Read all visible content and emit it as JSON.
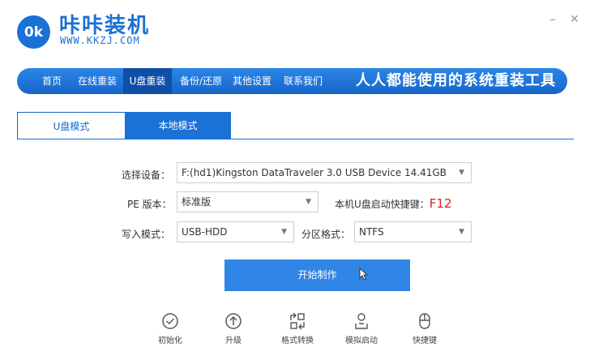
{
  "header": {
    "logo_text": "0k",
    "brand": "咔咔装机",
    "url": "WWW.KKZJ.COM",
    "minimize": "–",
    "close": "✕"
  },
  "nav": {
    "items": [
      {
        "label": "首页"
      },
      {
        "label": "在线重装"
      },
      {
        "label": "U盘重装"
      },
      {
        "label": "备份/还原"
      },
      {
        "label": "其他设置"
      },
      {
        "label": "联系我们"
      }
    ],
    "active_index": 2,
    "slogan": "人人都能使用的系统重装工具"
  },
  "tabs": [
    {
      "label": "U盘模式"
    },
    {
      "label": "本地模式"
    }
  ],
  "form": {
    "device_label": "选择设备：",
    "device_value": "F:(hd1)Kingston DataTraveler 3.0 USB Device 14.41GB",
    "pe_label": "PE 版本：",
    "pe_value": "标准版",
    "hotkey_label": "本机U盘启动快捷键：",
    "hotkey_value": "F12",
    "write_label": "写入模式：",
    "write_value": "USB-HDD",
    "partition_label": "分区格式：",
    "partition_value": "NTFS"
  },
  "start_button": "开始制作",
  "tools": [
    {
      "label": "初始化",
      "icon": "check-circle-icon"
    },
    {
      "label": "升级",
      "icon": "arrow-up-circle-icon"
    },
    {
      "label": "格式转换",
      "icon": "format-convert-icon"
    },
    {
      "label": "模拟启动",
      "icon": "user-boot-icon"
    },
    {
      "label": "快捷键",
      "icon": "mouse-icon"
    }
  ],
  "colors": {
    "primary": "#1a71d6",
    "nav_active": "#0f4fa8",
    "hotkey": "#e31c1c",
    "button": "#2f86e6"
  }
}
